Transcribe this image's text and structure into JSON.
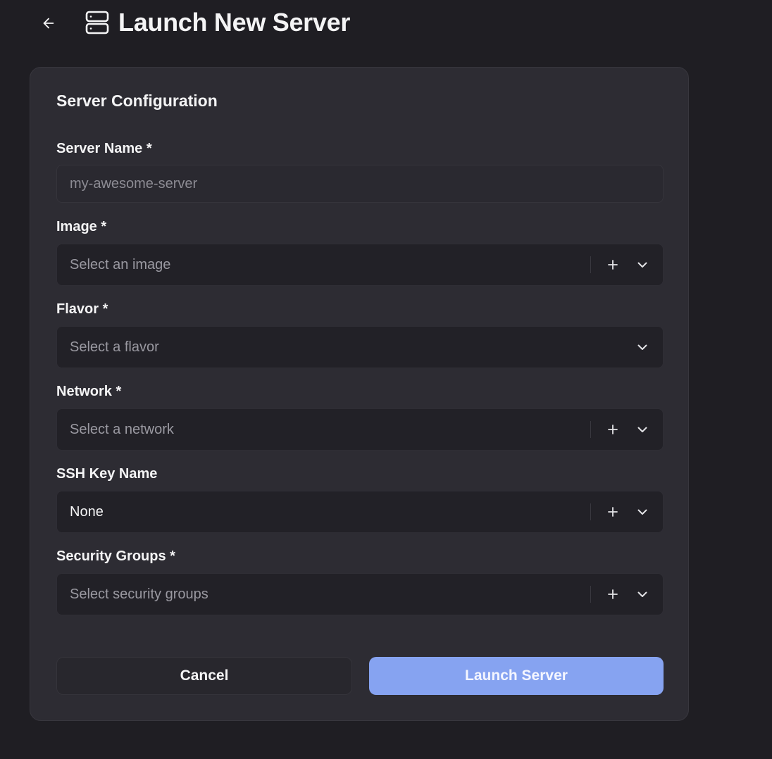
{
  "header": {
    "title": "Launch New Server",
    "back_icon": "arrow-left-icon",
    "title_icon": "server-icon"
  },
  "card": {
    "title": "Server Configuration",
    "fields": {
      "server_name": {
        "label": "Server Name *",
        "placeholder": "my-awesome-server",
        "value": ""
      },
      "image": {
        "label": "Image *",
        "placeholder": "Select an image"
      },
      "flavor": {
        "label": "Flavor *",
        "placeholder": "Select a flavor"
      },
      "network": {
        "label": "Network *",
        "placeholder": "Select a network"
      },
      "ssh_key": {
        "label": "SSH Key Name",
        "value": "None"
      },
      "security_groups": {
        "label": "Security Groups *",
        "placeholder": "Select security groups"
      }
    },
    "actions": {
      "cancel_label": "Cancel",
      "launch_label": "Launch Server"
    }
  },
  "colors": {
    "background": "#1f1e23",
    "card": "#2d2c33",
    "select_bg": "#222127",
    "accent": "#86a3f1",
    "text": "#f4f4f5",
    "placeholder": "#8d8c94"
  }
}
